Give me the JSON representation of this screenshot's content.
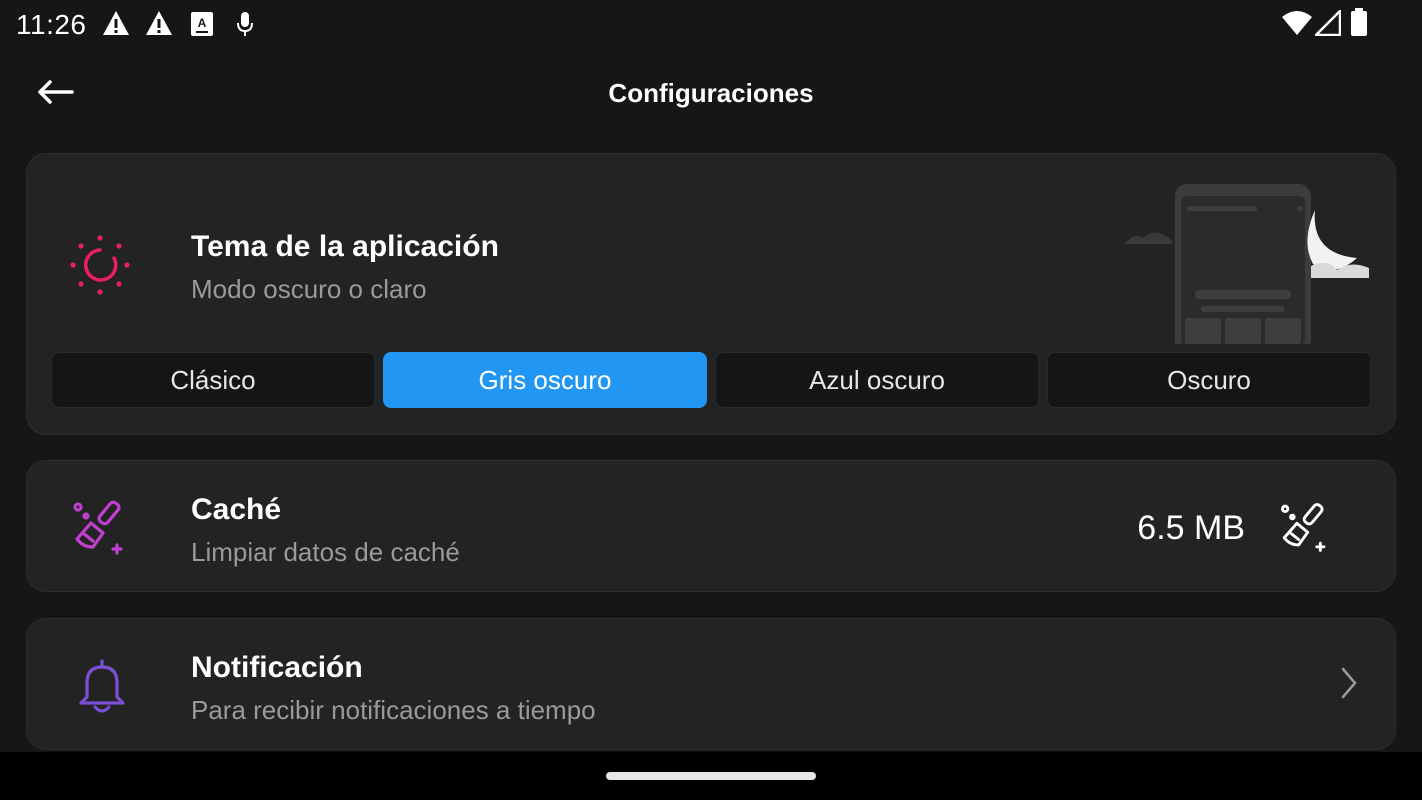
{
  "status_bar": {
    "time": "11:26",
    "left_icons": [
      "warning-icon",
      "warning-icon",
      "text-box-icon",
      "microphone-icon"
    ],
    "right_icons": [
      "wifi-icon",
      "cell-signal-icon",
      "battery-icon"
    ]
  },
  "header": {
    "title": "Configuraciones",
    "back_icon": "arrow-left-icon"
  },
  "theme": {
    "icon": "sun-icon",
    "title": "Tema de la aplicación",
    "subtitle": "Modo oscuro o claro",
    "options": [
      "Clásico",
      "Gris oscuro",
      "Azul oscuro",
      "Oscuro"
    ],
    "selected": "Gris oscuro"
  },
  "cache": {
    "icon": "broom-icon",
    "title": "Caché",
    "subtitle": "Limpiar datos de caché",
    "size": "6.5 MB",
    "action_icon": "broom-icon"
  },
  "notification": {
    "icon": "bell-icon",
    "title": "Notificación",
    "subtitle": "Para recibir notificaciones a tiempo",
    "chevron_icon": "chevron-right-icon"
  },
  "colors": {
    "background": "#161616",
    "card": "#232323",
    "accent": "#2196f3",
    "sun_icon": "#e91e63",
    "broom_icon": "#c13fd0",
    "bell_icon": "#7b4fd6"
  }
}
